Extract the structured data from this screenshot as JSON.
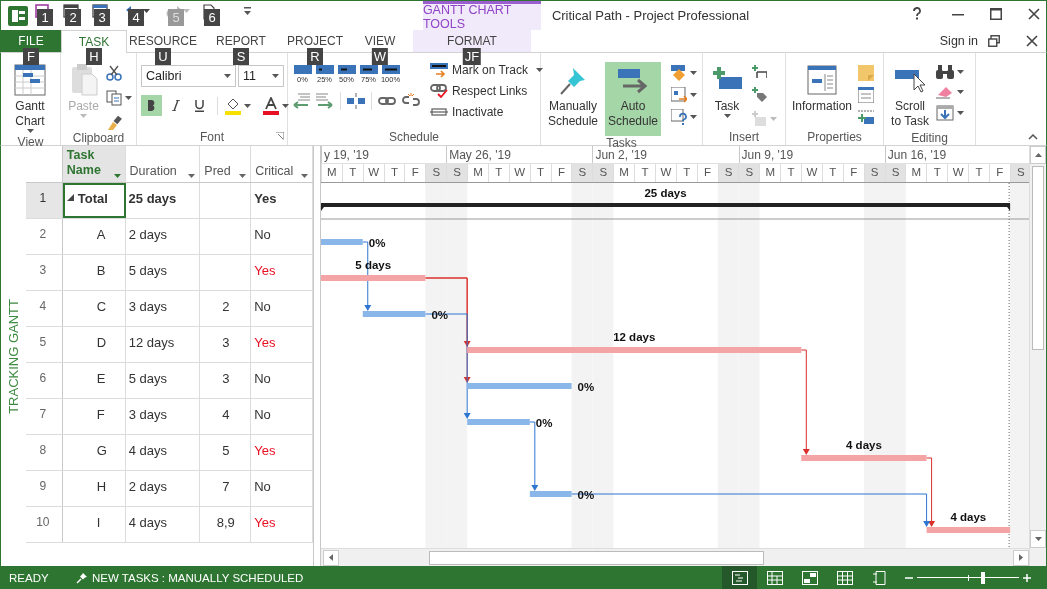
{
  "title_bar": {
    "context_label": "GANTT CHART TOOLS",
    "title": "Critical Path - Project Professional",
    "quick_access": [
      {
        "keytip": "1",
        "disabled": false
      },
      {
        "keytip": "2",
        "disabled": false
      },
      {
        "keytip": "3",
        "disabled": false
      },
      {
        "keytip": "4",
        "disabled": false
      },
      {
        "keytip": "5",
        "disabled": true
      },
      {
        "keytip": "6",
        "disabled": false
      }
    ]
  },
  "tabs": [
    {
      "label": "FILE",
      "kind": "file",
      "keytip": "F",
      "selected": false
    },
    {
      "label": "TASK",
      "kind": "tab",
      "keytip": "H",
      "selected": true
    },
    {
      "label": "RESOURCE",
      "kind": "tab",
      "keytip": "U",
      "selected": false
    },
    {
      "label": "REPORT",
      "kind": "tab",
      "keytip": "S",
      "selected": false
    },
    {
      "label": "PROJECT",
      "kind": "tab",
      "keytip": "R",
      "selected": false
    },
    {
      "label": "VIEW",
      "kind": "tab",
      "keytip": "W",
      "selected": false
    },
    {
      "label": "FORMAT",
      "kind": "contextual",
      "keytip": "JF",
      "selected": false
    }
  ],
  "account": {
    "sign_in": "Sign in"
  },
  "ribbon": {
    "groups": [
      {
        "label": "View",
        "kind": "view",
        "buttons": [
          {
            "label": "Gantt Chart"
          }
        ]
      },
      {
        "label": "Clipboard",
        "kind": "clipboard",
        "buttons": [
          {
            "label": "Paste",
            "disabled": true
          }
        ]
      },
      {
        "label": "Font",
        "kind": "font",
        "font": "Calibri",
        "size": "11",
        "bold": true,
        "italic": false,
        "underline": false
      },
      {
        "label": "Schedule",
        "kind": "schedule",
        "percents": [
          "0%",
          "25%",
          "50%",
          "75%",
          "100%"
        ],
        "buttons": [
          {
            "label": "Mark on Track"
          },
          {
            "label": "Respect Links"
          },
          {
            "label": "Inactivate"
          }
        ]
      },
      {
        "label": "Tasks",
        "kind": "tasks",
        "buttons": [
          {
            "label": "Manually Schedule",
            "selected": false
          },
          {
            "label": "Auto Schedule",
            "selected": true
          }
        ]
      },
      {
        "label": "Insert",
        "kind": "insert",
        "buttons": [
          {
            "label": "Task"
          }
        ]
      },
      {
        "label": "Properties",
        "kind": "properties",
        "buttons": [
          {
            "label": "Information"
          }
        ]
      },
      {
        "label": "Editing",
        "kind": "editing",
        "buttons": [
          {
            "label": "Scroll to Task"
          }
        ]
      }
    ]
  },
  "view_bar": {
    "label": "TRACKING GANTT"
  },
  "table": {
    "columns": [
      {
        "label": "Task Name",
        "selected": true
      },
      {
        "label": "Duration",
        "selected": false
      },
      {
        "label": "Pred",
        "selected": false
      },
      {
        "label": "Critical",
        "selected": false
      }
    ],
    "rows": [
      {
        "id": "1",
        "name": "Total",
        "duration": "25 days",
        "critical_text": "Yes",
        "selected": true,
        "expanded": true,
        "bar_label": "25 days",
        "children": [
          {
            "id": "2",
            "name": "A",
            "duration": "2 days",
            "critical_text": "No",
            "critical": false,
            "selected": false,
            "bar_label": "0%"
          },
          {
            "id": "3",
            "name": "B",
            "duration": "5 days",
            "critical_text": "Yes",
            "critical": true,
            "selected": false,
            "bar_label": "5 days"
          },
          {
            "id": "4",
            "name": "C",
            "duration": "3 days",
            "pred": "2",
            "critical_text": "No",
            "critical": false,
            "selected": false,
            "bar_label": "0%"
          },
          {
            "id": "5",
            "name": "D",
            "duration": "12 days",
            "pred": "3",
            "critical_text": "Yes",
            "critical": true,
            "selected": false,
            "bar_label": "12 days"
          },
          {
            "id": "6",
            "name": "E",
            "duration": "5 days",
            "pred": "3",
            "critical_text": "No",
            "critical": false,
            "selected": false,
            "bar_label": "0%"
          },
          {
            "id": "7",
            "name": "F",
            "duration": "3 days",
            "pred": "4",
            "critical_text": "No",
            "critical": false,
            "selected": false,
            "bar_label": "0%"
          },
          {
            "id": "8",
            "name": "G",
            "duration": "4 days",
            "pred": "5",
            "critical_text": "Yes",
            "critical": true,
            "selected": false,
            "bar_label": "4 days"
          },
          {
            "id": "9",
            "name": "H",
            "duration": "2 days",
            "pred": "7",
            "critical_text": "No",
            "critical": false,
            "selected": false,
            "bar_label": "0%"
          },
          {
            "id": "10",
            "name": "I",
            "duration": "4 days",
            "pred": "8,9",
            "critical_text": "Yes",
            "critical": true,
            "selected": false,
            "bar_label": "4 days"
          }
        ]
      }
    ]
  },
  "timescale": {
    "weeks": [
      {
        "label": "y 19, '19",
        "days": [
          {
            "letter": "M",
            "nonworking": false
          },
          {
            "letter": "T",
            "nonworking": false
          },
          {
            "letter": "W",
            "nonworking": false
          },
          {
            "letter": "T",
            "nonworking": false
          },
          {
            "letter": "F",
            "nonworking": false
          },
          {
            "letter": "S",
            "nonworking": true
          }
        ]
      },
      {
        "label": "May 26, '19",
        "days": [
          {
            "letter": "S",
            "nonworking": true
          },
          {
            "letter": "M",
            "nonworking": false
          },
          {
            "letter": "T",
            "nonworking": false
          },
          {
            "letter": "W",
            "nonworking": false
          },
          {
            "letter": "T",
            "nonworking": false
          },
          {
            "letter": "F",
            "nonworking": false
          },
          {
            "letter": "S",
            "nonworking": true
          }
        ]
      },
      {
        "label": "Jun 2, '19",
        "days": [
          {
            "letter": "S",
            "nonworking": true
          },
          {
            "letter": "M",
            "nonworking": false
          },
          {
            "letter": "T",
            "nonworking": false
          },
          {
            "letter": "W",
            "nonworking": false
          },
          {
            "letter": "T",
            "nonworking": false
          },
          {
            "letter": "F",
            "nonworking": false
          },
          {
            "letter": "S",
            "nonworking": true
          }
        ]
      },
      {
        "label": "Jun 9, '19",
        "days": [
          {
            "letter": "S",
            "nonworking": true
          },
          {
            "letter": "M",
            "nonworking": false
          },
          {
            "letter": "T",
            "nonworking": false
          },
          {
            "letter": "W",
            "nonworking": false
          },
          {
            "letter": "T",
            "nonworking": false
          },
          {
            "letter": "F",
            "nonworking": false
          },
          {
            "letter": "S",
            "nonworking": true
          }
        ]
      },
      {
        "label": "Jun 16, '19",
        "days": [
          {
            "letter": "S",
            "nonworking": true
          },
          {
            "letter": "M",
            "nonworking": false
          },
          {
            "letter": "T",
            "nonworking": false
          },
          {
            "letter": "W",
            "nonworking": false
          },
          {
            "letter": "T",
            "nonworking": false
          },
          {
            "letter": "F",
            "nonworking": false
          },
          {
            "letter": "S",
            "nonworking": true
          }
        ]
      }
    ]
  },
  "status_bar": {
    "mode": "READY",
    "new_tasks": "NEW TASKS : MANUALLY SCHEDULED",
    "views": [
      {
        "selected": true
      },
      {
        "selected": false
      },
      {
        "selected": false
      },
      {
        "selected": false
      },
      {
        "selected": false
      }
    ],
    "zoom": {
      "level": 0.65
    }
  }
}
